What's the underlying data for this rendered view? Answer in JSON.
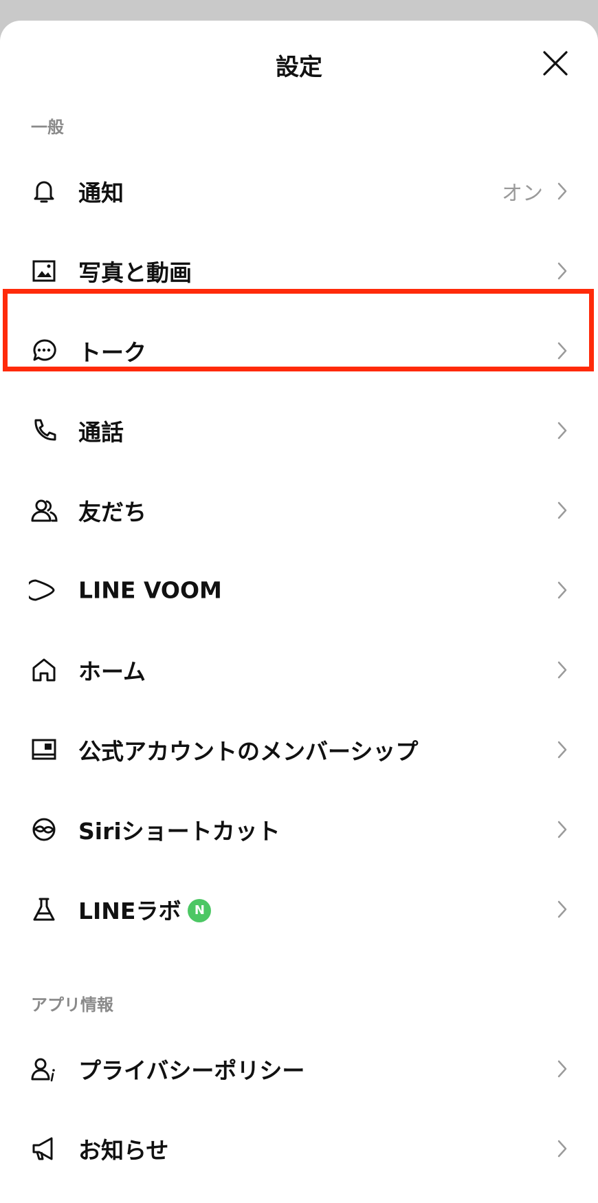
{
  "header": {
    "title": "設定",
    "close_icon": "close-icon"
  },
  "sections": [
    {
      "label": "一般",
      "items": [
        {
          "label": "通知",
          "value": "オン",
          "icon": "bell-icon"
        },
        {
          "label": "写真と動画",
          "value": "",
          "icon": "photo-icon"
        },
        {
          "label": "トーク",
          "value": "",
          "icon": "chat-bubble-icon",
          "highlighted": true
        },
        {
          "label": "通話",
          "value": "",
          "icon": "phone-icon"
        },
        {
          "label": "友だち",
          "value": "",
          "icon": "friends-icon"
        },
        {
          "label": "LINE VOOM",
          "value": "",
          "icon": "voom-icon"
        },
        {
          "label": "ホーム",
          "value": "",
          "icon": "home-icon"
        },
        {
          "label": "公式アカウントのメンバーシップ",
          "value": "",
          "icon": "membership-icon"
        },
        {
          "label": "Siriショートカット",
          "value": "",
          "icon": "siri-icon"
        },
        {
          "label": "LINEラボ",
          "value": "",
          "icon": "flask-icon",
          "badge": "N"
        }
      ]
    },
    {
      "label": "アプリ情報",
      "items": [
        {
          "label": "プライバシーポリシー",
          "value": "",
          "icon": "privacy-user-icon"
        },
        {
          "label": "お知らせ",
          "value": "",
          "icon": "megaphone-icon"
        }
      ]
    }
  ],
  "colors": {
    "highlight_border": "#ff2a0a",
    "badge_green": "#4cc764",
    "secondary_text": "#9a9a9a"
  }
}
